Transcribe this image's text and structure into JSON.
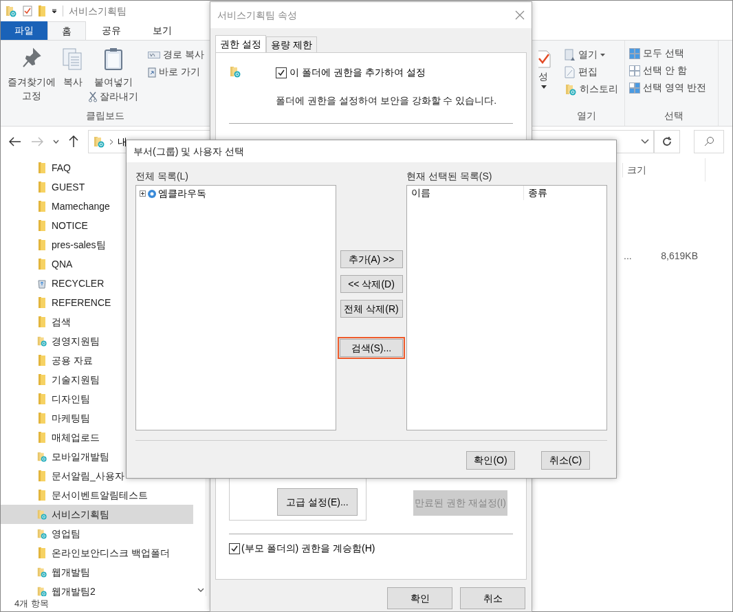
{
  "explorer": {
    "title": "서비스기획팀",
    "ribbon_tabs": [
      {
        "label": "파일",
        "kind": "file",
        "selected": false
      },
      {
        "label": "홈",
        "kind": "tab",
        "selected": true
      },
      {
        "label": "공유",
        "kind": "tab",
        "selected": false
      },
      {
        "label": "보기",
        "kind": "tab",
        "selected": false
      }
    ],
    "clipboard": {
      "label": "클립보드",
      "pin": "즐겨찾기에\n고정",
      "copy": "복사",
      "paste": "붙여넣기",
      "cut": "잘라내기",
      "copy_path": "경로 복사",
      "shortcut": "바로 가기"
    },
    "properties_partial": "성",
    "open_group": {
      "label": "열기",
      "open": "열기",
      "edit": "편집",
      "history": "히스토리"
    },
    "select_group": {
      "label": "선택",
      "select_all": "모두 선택",
      "select_none": "선택 안 함",
      "invert": "선택 영역 반전"
    },
    "address": "내",
    "nav_items": [
      {
        "label": "FAQ",
        "kind": "folder",
        "selected": false
      },
      {
        "label": "GUEST",
        "kind": "folder",
        "selected": false
      },
      {
        "label": "Mamechange",
        "kind": "folder",
        "selected": false
      },
      {
        "label": "NOTICE",
        "kind": "folder",
        "selected": false
      },
      {
        "label": "pres-sales팀",
        "kind": "folder",
        "selected": false
      },
      {
        "label": "QNA",
        "kind": "folder",
        "selected": false
      },
      {
        "label": "RECYCLER",
        "kind": "recycle",
        "selected": false
      },
      {
        "label": "REFERENCE",
        "kind": "folder",
        "selected": false
      },
      {
        "label": "검색",
        "kind": "folder",
        "selected": false
      },
      {
        "label": "경영지원팀",
        "kind": "synced",
        "selected": false
      },
      {
        "label": "공용 자료",
        "kind": "folder",
        "selected": false
      },
      {
        "label": "기술지원팀",
        "kind": "folder",
        "selected": false
      },
      {
        "label": "디자인팀",
        "kind": "folder",
        "selected": false
      },
      {
        "label": "마케팅팀",
        "kind": "folder",
        "selected": false
      },
      {
        "label": "매체업로드",
        "kind": "folder",
        "selected": false
      },
      {
        "label": "모바일개발팀",
        "kind": "synced",
        "selected": false
      },
      {
        "label": "문서알림_사용자",
        "kind": "folder",
        "selected": false
      },
      {
        "label": "문서이벤트알림테스트",
        "kind": "folder",
        "selected": false
      },
      {
        "label": "서비스기획팀",
        "kind": "synced",
        "selected": true
      },
      {
        "label": "영업팀",
        "kind": "synced",
        "selected": false
      },
      {
        "label": "온라인보안디스크 백업폴더",
        "kind": "folder",
        "selected": false
      },
      {
        "label": "웹개발팀",
        "kind": "synced",
        "selected": false
      },
      {
        "label": "웹개발팀2",
        "kind": "synced",
        "selected": false
      }
    ],
    "column_size": "크기",
    "row": {
      "truncated": "...",
      "size": "8,619KB"
    },
    "status": "4개 항목"
  },
  "properties": {
    "title": "서비스기획팀 속성",
    "tabs": [
      {
        "label": "권한 설정",
        "selected": true
      },
      {
        "label": "용량 제한",
        "selected": false
      }
    ],
    "enable": {
      "label": "이 폴더에 권한을 추가하여 설정",
      "checked": true
    },
    "description": "폴더에 권한을 설정하여 보안을 강화할 수 있습니다.",
    "advanced_button": "고급 설정(E)...",
    "reset_button": {
      "label": "만료된 권한 재설정(I)",
      "disabled": true
    },
    "inherit": {
      "label": "(부모 폴더의) 권한을 계승함(H)",
      "checked": true
    },
    "buttons": [
      "확인",
      "취소"
    ]
  },
  "select_dialog": {
    "title": "부서(그룹) 및 사용자 선택",
    "all_label": "전체 목록(L)",
    "tree": [
      {
        "label": "엠클라우독",
        "expanded": false
      }
    ],
    "selected_label": "현재 선택된 목록(S)",
    "columns": [
      "이름",
      "종류"
    ],
    "middle_buttons": [
      {
        "label": "추가(A) >>",
        "focused": false
      },
      {
        "label": "<< 삭제(D)",
        "focused": false
      },
      {
        "label": "전체 삭제(R)",
        "focused": false
      },
      {
        "label": "검색(S)...",
        "focused": true
      }
    ],
    "buttons": [
      "확인(O)",
      "취소(C)"
    ]
  }
}
